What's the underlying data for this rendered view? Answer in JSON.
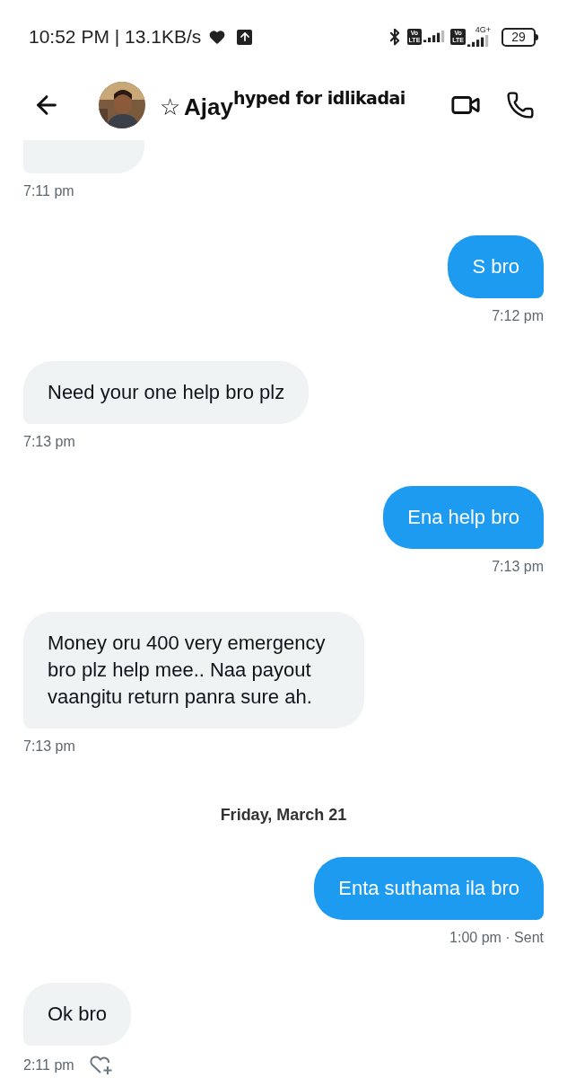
{
  "status_bar": {
    "time": "10:52 PM | 13.1KB/s",
    "sim_badges": [
      {
        "top": "Vo",
        "bottom": "LTE"
      },
      {
        "top": "Vo",
        "bottom": "LTE",
        "network": "4G+"
      }
    ],
    "battery": "29"
  },
  "header": {
    "star": "☆",
    "name": "Ajay",
    "status": "hyped for idlikadai"
  },
  "messages": [
    {
      "kind": "cut",
      "time": "7:11 pm"
    },
    {
      "kind": "sent",
      "text": "S bro",
      "time": "7:12 pm"
    },
    {
      "kind": "received",
      "text": "Need your one help bro plz",
      "time": "7:13 pm"
    },
    {
      "kind": "sent",
      "text": "Ena help bro",
      "time": "7:13 pm"
    },
    {
      "kind": "received",
      "text": "Money oru 400 very emergency bro plz help mee.. Naa payout vaangitu return panra sure ah.",
      "time": "7:13 pm"
    },
    {
      "kind": "date",
      "text": "Friday, March 21"
    },
    {
      "kind": "sent",
      "text": "Enta suthama ila bro",
      "time": "1:00 pm · Sent"
    },
    {
      "kind": "received",
      "text": "Ok bro",
      "time": "2:11 pm",
      "reaction_button": true
    }
  ]
}
